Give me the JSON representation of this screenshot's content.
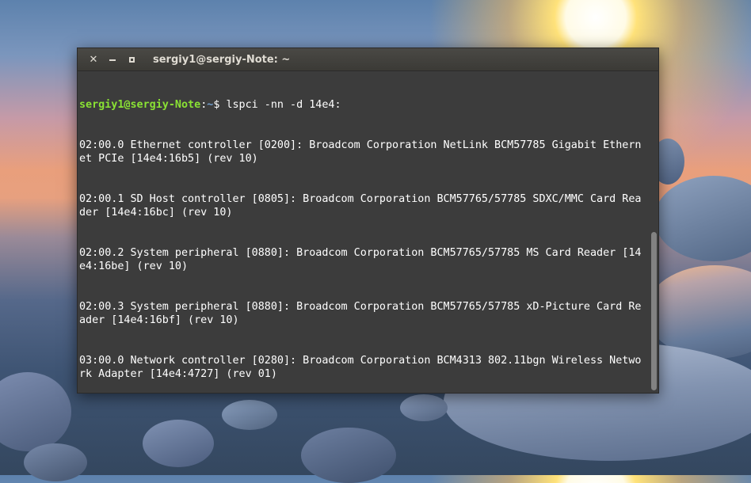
{
  "window": {
    "title": "sergiy1@sergiy-Note: ~",
    "close_glyph": "✕",
    "icons": [
      "close-icon",
      "minimize-icon",
      "maximize-icon"
    ]
  },
  "terminal": {
    "prompt_user_host": "sergiy1@sergiy-Note",
    "prompt_separator": ":",
    "prompt_path": "~",
    "prompt_symbol": "$ ",
    "command": "lspci -nn -d 14e4:",
    "output": [
      "02:00.0 Ethernet controller [0200]: Broadcom Corporation NetLink BCM57785 Gigabit Ethernet PCIe [14e4:16b5] (rev 10)",
      "02:00.1 SD Host controller [0805]: Broadcom Corporation BCM57765/57785 SDXC/MMC Card Reader [14e4:16bc] (rev 10)",
      "02:00.2 System peripheral [0880]: Broadcom Corporation BCM57765/57785 MS Card Reader [14e4:16be] (rev 10)",
      "02:00.3 System peripheral [0880]: Broadcom Corporation BCM57765/57785 xD-Picture Card Reader [14e4:16bf] (rev 10)",
      "03:00.0 Network controller [0280]: Broadcom Corporation BCM4313 802.11bgn Wireless Network Adapter [14e4:4727] (rev 01)"
    ]
  },
  "colors": {
    "terminal_bg": "#3c3c3c",
    "prompt_user": "#8ae234",
    "prompt_path": "#729fcf",
    "text": "#ffffff"
  }
}
